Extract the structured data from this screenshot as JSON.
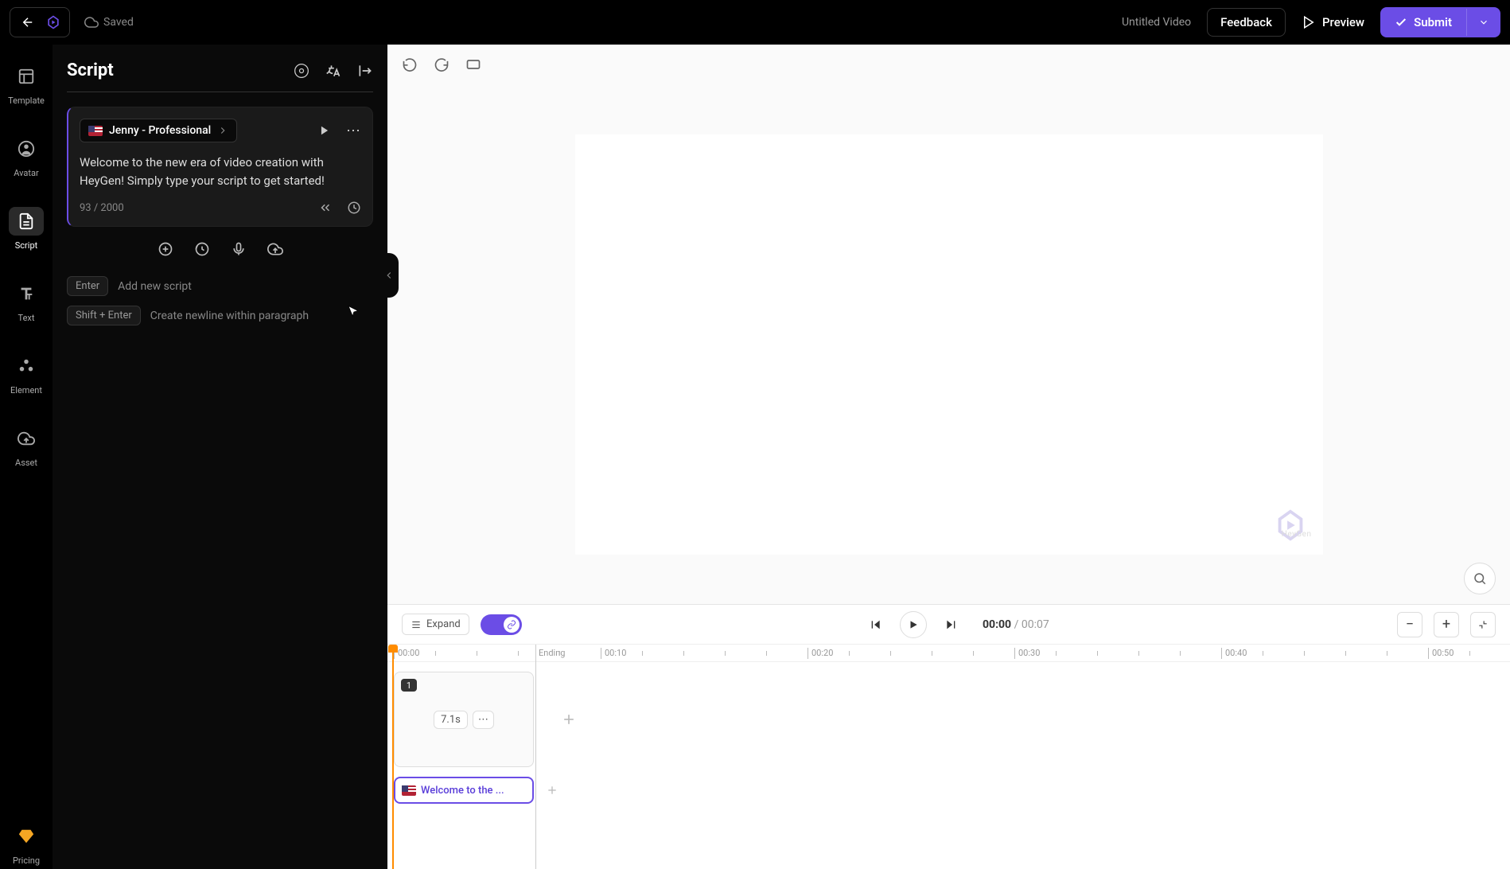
{
  "topbar": {
    "saved_label": "Saved",
    "video_title": "Untitled Video",
    "feedback_label": "Feedback",
    "preview_label": "Preview",
    "submit_label": "Submit"
  },
  "sidebar": {
    "items": [
      {
        "label": "Template",
        "name": "template"
      },
      {
        "label": "Avatar",
        "name": "avatar"
      },
      {
        "label": "Script",
        "name": "script"
      },
      {
        "label": "Text",
        "name": "text"
      },
      {
        "label": "Element",
        "name": "element"
      },
      {
        "label": "Asset",
        "name": "asset"
      }
    ],
    "pricing_label": "Pricing"
  },
  "panel": {
    "title": "Script",
    "voice": {
      "label": "Jenny - Professional",
      "flag": "us"
    },
    "script_text": "Welcome to the new era of video creation with HeyGen! Simply type your script to get started!",
    "char_count": "93 / 2000",
    "hints": [
      {
        "kbd": "Enter",
        "text": "Add new script"
      },
      {
        "kbd": "Shift + Enter",
        "text": "Create newline within paragraph"
      }
    ]
  },
  "canvas": {
    "watermark_text": "HeyGen"
  },
  "timeline": {
    "expand_label": "Expand",
    "current_time": "00:00",
    "total_time": "00:07",
    "ruler": [
      {
        "pos": 8,
        "label": "00:00"
      },
      {
        "pos": 268,
        "label": "00:10"
      },
      {
        "pos": 528,
        "label": "00:20"
      },
      {
        "pos": 788,
        "label": "00:30"
      },
      {
        "pos": 1048,
        "label": "00:40"
      },
      {
        "pos": 1308,
        "label": "00:50"
      }
    ],
    "ending_label": "Ending",
    "scene": {
      "num": "1",
      "duration": "7.1s"
    },
    "audio_label": "Welcome to the ..."
  },
  "colors": {
    "accent": "#6b4de6",
    "playhead": "#ff8c00"
  }
}
